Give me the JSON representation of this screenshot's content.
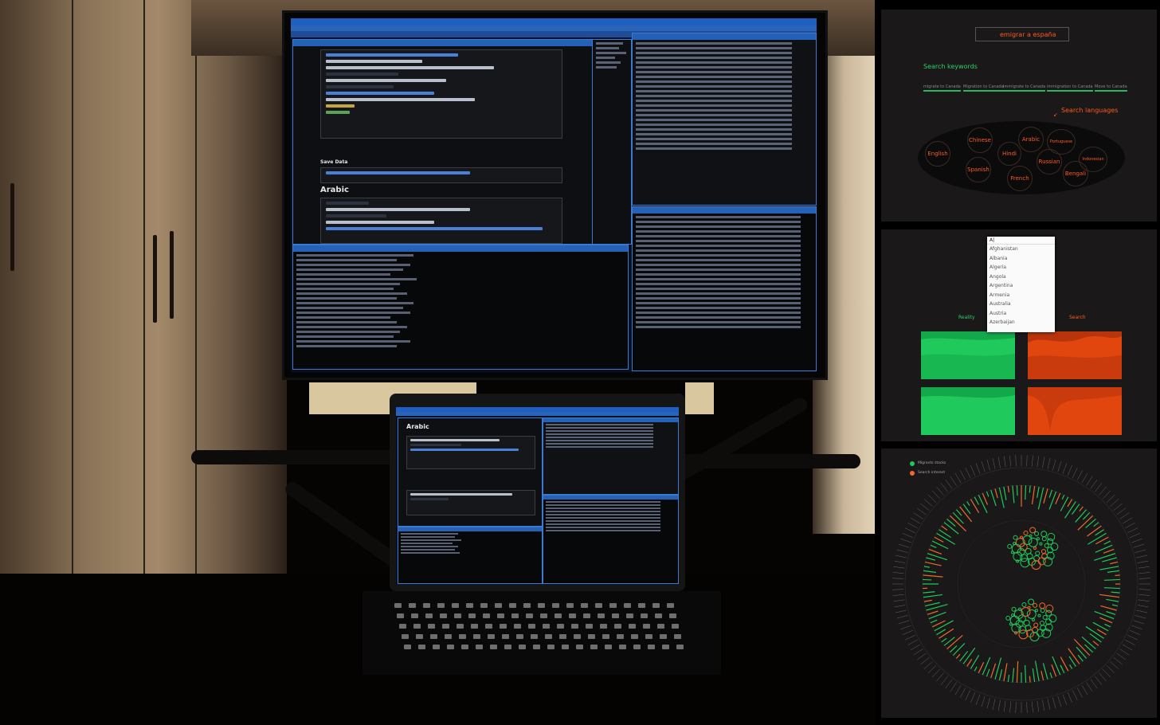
{
  "workspace": {
    "section_heading": "Save Data",
    "chunk_heading": "Arabic",
    "laptop_heading": "Arabic"
  },
  "panel_search": {
    "query": "emigrar a españa",
    "keywords_title": "Search keywords",
    "keywords": [
      "migrate to Canada",
      "Migration to Canada",
      "Immigrate to Canada",
      "immigration to Canada",
      "Move to Canada"
    ],
    "languages_title": "Search languages",
    "languages": [
      "English",
      "Chinese",
      "Spanish",
      "Hindi",
      "Arabic",
      "Russian",
      "French",
      "Portuguese",
      "Bengali",
      "Indonesian"
    ],
    "colors": {
      "keyword": "#2bd16b",
      "language": "#ff5a1f"
    }
  },
  "panel_compare": {
    "dropdown_input": "A|",
    "countries": [
      "Afghanistan",
      "Albania",
      "Algeria",
      "Angola",
      "Argentina",
      "Armenia",
      "Australia",
      "Austria",
      "Azerbaijan"
    ],
    "reality_label": "Reality",
    "search_label": "Search",
    "colors": {
      "reality": "#1fc95c",
      "search": "#e2460f"
    }
  },
  "panel_radial": {
    "legend": [
      {
        "label": "Migrants stocks",
        "color": "#1fc95c"
      },
      {
        "label": "Search interest",
        "color": "#f06a2a"
      }
    ]
  }
}
